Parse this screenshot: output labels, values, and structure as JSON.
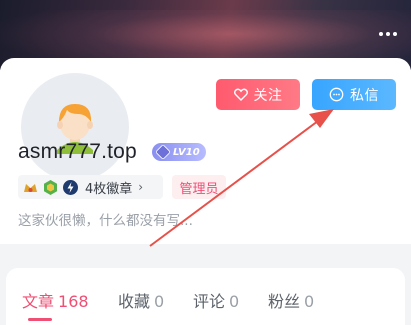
{
  "header": {
    "more_icon": "more-dots-icon"
  },
  "profile": {
    "username": "asmr777.top",
    "level": "LV10",
    "badges_label": "4枚徽章",
    "badges_chevron": "›",
    "role": "管理员",
    "bio": "这家伙很懒，什么都没有写..."
  },
  "actions": {
    "follow_label": "关注",
    "message_label": "私信",
    "follow_color": "#ff5a6e",
    "message_color": "#37a5ff"
  },
  "tabs": [
    {
      "label": "文章",
      "count": "168",
      "active": true
    },
    {
      "label": "收藏",
      "count": "0",
      "active": false
    },
    {
      "label": "评论",
      "count": "0",
      "active": false
    },
    {
      "label": "粉丝",
      "count": "0",
      "active": false
    }
  ],
  "accent": "#ef4f74",
  "annotation_color": "#e8504a"
}
